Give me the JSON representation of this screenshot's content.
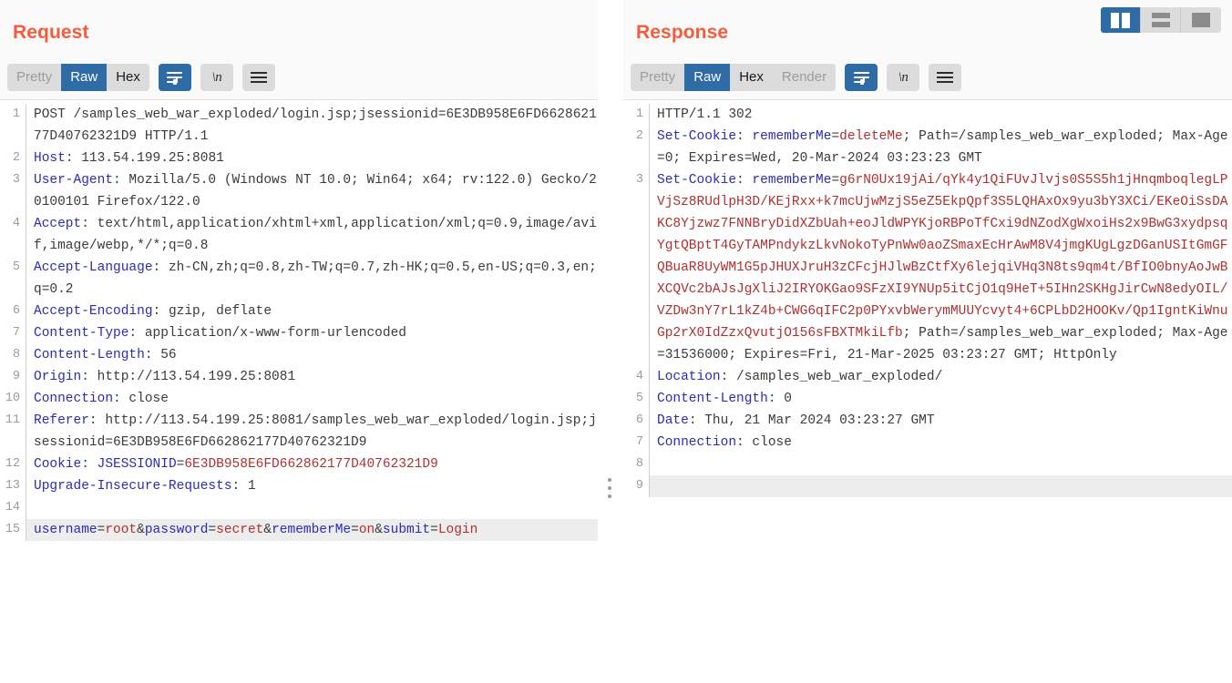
{
  "layout_switcher": {
    "buttons": [
      {
        "name": "side-by-side",
        "label": "",
        "active": true
      },
      {
        "name": "stacked",
        "label": "",
        "active": false
      },
      {
        "name": "single",
        "label": "",
        "active": false
      }
    ]
  },
  "request": {
    "title": "Request",
    "tabs": [
      {
        "label": "Pretty",
        "state": "disabled"
      },
      {
        "label": "Raw",
        "state": "active"
      },
      {
        "label": "Hex",
        "state": "normal"
      }
    ],
    "buttons": {
      "word_wrap": {
        "icon": "word-wrap-icon",
        "active": true
      },
      "special_chars": {
        "icon": "newline-icon",
        "label": "\\n",
        "active": false
      },
      "menu": {
        "icon": "hamburger-menu-icon",
        "active": false
      }
    },
    "lines": [
      {
        "n": "1",
        "segs": [
          {
            "t": "POST /samples_web_war_exploded/login.jsp;jsessionid=6E3DB958E6FD662862177D40762321D9 HTTP/1.1",
            "c": "p"
          }
        ]
      },
      {
        "n": "2",
        "segs": [
          {
            "t": "Host",
            "c": "k"
          },
          {
            "t": ": ",
            "c": "p"
          },
          {
            "t": "113.54.199.25:8081",
            "c": "p"
          }
        ]
      },
      {
        "n": "3",
        "segs": [
          {
            "t": "User-Agent",
            "c": "k"
          },
          {
            "t": ": ",
            "c": "p"
          },
          {
            "t": "Mozilla/5.0 (Windows NT 10.0; Win64; x64; rv:122.0) Gecko/20100101 Firefox/122.0",
            "c": "p"
          }
        ]
      },
      {
        "n": "4",
        "segs": [
          {
            "t": "Accept",
            "c": "k"
          },
          {
            "t": ": ",
            "c": "p"
          },
          {
            "t": "text/html,application/xhtml+xml,application/xml;q=0.9,image/avif,image/webp,*/*;q=0.8",
            "c": "p"
          }
        ]
      },
      {
        "n": "5",
        "segs": [
          {
            "t": "Accept-Language",
            "c": "k"
          },
          {
            "t": ": ",
            "c": "p"
          },
          {
            "t": "zh-CN,zh;q=0.8,zh-TW;q=0.7,zh-HK;q=0.5,en-US;q=0.3,en;q=0.2",
            "c": "p"
          }
        ]
      },
      {
        "n": "6",
        "segs": [
          {
            "t": "Accept-Encoding",
            "c": "k"
          },
          {
            "t": ": ",
            "c": "p"
          },
          {
            "t": "gzip, deflate",
            "c": "p"
          }
        ]
      },
      {
        "n": "7",
        "segs": [
          {
            "t": "Content-Type",
            "c": "k"
          },
          {
            "t": ": ",
            "c": "p"
          },
          {
            "t": "application/x-www-form-urlencoded",
            "c": "p"
          }
        ]
      },
      {
        "n": "8",
        "segs": [
          {
            "t": "Content-Length",
            "c": "k"
          },
          {
            "t": ": ",
            "c": "p"
          },
          {
            "t": "56",
            "c": "p"
          }
        ]
      },
      {
        "n": "9",
        "segs": [
          {
            "t": "Origin",
            "c": "k"
          },
          {
            "t": ": ",
            "c": "p"
          },
          {
            "t": "http://113.54.199.25:8081",
            "c": "p"
          }
        ]
      },
      {
        "n": "10",
        "segs": [
          {
            "t": "Connection",
            "c": "k"
          },
          {
            "t": ": ",
            "c": "p"
          },
          {
            "t": "close",
            "c": "p"
          }
        ]
      },
      {
        "n": "11",
        "segs": [
          {
            "t": "Referer",
            "c": "k"
          },
          {
            "t": ": ",
            "c": "p"
          },
          {
            "t": "http://113.54.199.25:8081/samples_web_war_exploded/login.jsp;jsessionid=6E3DB958E6FD662862177D40762321D9",
            "c": "p"
          }
        ]
      },
      {
        "n": "12",
        "segs": [
          {
            "t": "Cookie",
            "c": "k"
          },
          {
            "t": ": ",
            "c": "p"
          },
          {
            "t": "JSESSIONID",
            "c": "k"
          },
          {
            "t": "=",
            "c": "p"
          },
          {
            "t": "6E3DB958E6FD662862177D40762321D9",
            "c": "r"
          }
        ]
      },
      {
        "n": "13",
        "segs": [
          {
            "t": "Upgrade-Insecure-Requests",
            "c": "k"
          },
          {
            "t": ": ",
            "c": "p"
          },
          {
            "t": "1",
            "c": "p"
          }
        ]
      },
      {
        "n": "14",
        "segs": []
      },
      {
        "n": "15",
        "highlight": true,
        "segs": [
          {
            "t": "username",
            "c": "k"
          },
          {
            "t": "=",
            "c": "p"
          },
          {
            "t": "root",
            "c": "r"
          },
          {
            "t": "&",
            "c": "p"
          },
          {
            "t": "password",
            "c": "k"
          },
          {
            "t": "=",
            "c": "p"
          },
          {
            "t": "secret",
            "c": "r"
          },
          {
            "t": "&",
            "c": "p"
          },
          {
            "t": "rememberMe",
            "c": "k"
          },
          {
            "t": "=",
            "c": "p"
          },
          {
            "t": "on",
            "c": "r"
          },
          {
            "t": "&",
            "c": "p"
          },
          {
            "t": "submit",
            "c": "k"
          },
          {
            "t": "=",
            "c": "p"
          },
          {
            "t": "Login",
            "c": "r"
          }
        ]
      }
    ]
  },
  "response": {
    "title": "Response",
    "tabs": [
      {
        "label": "Pretty",
        "state": "disabled"
      },
      {
        "label": "Raw",
        "state": "active"
      },
      {
        "label": "Hex",
        "state": "normal"
      },
      {
        "label": "Render",
        "state": "disabled"
      }
    ],
    "buttons": {
      "word_wrap": {
        "icon": "word-wrap-icon",
        "active": true
      },
      "special_chars": {
        "icon": "newline-icon",
        "label": "\\n",
        "active": false
      },
      "menu": {
        "icon": "hamburger-menu-icon",
        "active": false
      }
    },
    "lines": [
      {
        "n": "1",
        "segs": [
          {
            "t": "HTTP/1.1 302",
            "c": "p"
          }
        ]
      },
      {
        "n": "2",
        "segs": [
          {
            "t": "Set-Cookie",
            "c": "k"
          },
          {
            "t": ": ",
            "c": "p"
          },
          {
            "t": "rememberMe",
            "c": "k"
          },
          {
            "t": "=",
            "c": "p"
          },
          {
            "t": "deleteMe",
            "c": "r"
          },
          {
            "t": "; Path=/samples_web_war_exploded; Max-Age=0; Expires=Wed, 20-Mar-2024 03:23:23 GMT",
            "c": "p"
          }
        ]
      },
      {
        "n": "3",
        "segs": [
          {
            "t": "Set-Cookie",
            "c": "k"
          },
          {
            "t": ": ",
            "c": "p"
          },
          {
            "t": "rememberMe",
            "c": "k"
          },
          {
            "t": "=",
            "c": "p"
          },
          {
            "t": "g6rN0Ux19jAi/qYk4y1QiFUvJlvjs0S5S5h1jHnqmboqlegLPVjSz8RUdlpH3D/KEjRxx+k7mcUjwMzjS5eZ5EkpQpf3S5LQHAxOx9yu3bY3XCi/EKeOiSsDAKC8Yjzwz7FNNBryDidXZbUah+eoJldWPYKjoRBPoTfCxi9dNZodXgWxoiHs2x9BwG3xydpsqYgtQBptT4GyTAMPndykzLkvNokoTyPnWw0aoZSmaxEcHrAwM8V4jmgKUgLgzDGanUSItGmGFQBuaR8UyWM1G5pJHUXJruH3zCFcjHJlwBzCtfXy6lejqiVHq3N8ts9qm4t/BfIO0bnyAoJwBXCQVc2bAJsJgXliJ2IRYOKGao9SFzXI9YNUp5itCjO1q9HeT+5IHn2SKHgJirCwN8edyOIL/VZDw3nY7rL1kZ4b+CWG6qIFC2p0PYxvbWerymMUUYcvyt4+6CPLbD2HOOKv/Qp1IgntKiWnuGp2rX0IdZzxQvutjO156sFBXTMkiLfb",
            "c": "r"
          },
          {
            "t": "; Path=/samples_web_war_exploded; Max-Age=31536000; Expires=Fri, 21-Mar-2025 03:23:27 GMT; HttpOnly",
            "c": "p"
          }
        ]
      },
      {
        "n": "4",
        "segs": [
          {
            "t": "Location",
            "c": "k"
          },
          {
            "t": ": ",
            "c": "p"
          },
          {
            "t": "/samples_web_war_exploded/",
            "c": "p"
          }
        ]
      },
      {
        "n": "5",
        "segs": [
          {
            "t": "Content-Length",
            "c": "k"
          },
          {
            "t": ": ",
            "c": "p"
          },
          {
            "t": "0",
            "c": "p"
          }
        ]
      },
      {
        "n": "6",
        "segs": [
          {
            "t": "Date",
            "c": "k"
          },
          {
            "t": ": ",
            "c": "p"
          },
          {
            "t": "Thu, 21 Mar 2024 03:23:27 GMT",
            "c": "p"
          }
        ]
      },
      {
        "n": "7",
        "segs": [
          {
            "t": "Connection",
            "c": "k"
          },
          {
            "t": ": ",
            "c": "p"
          },
          {
            "t": "close",
            "c": "p"
          }
        ]
      },
      {
        "n": "8",
        "segs": []
      },
      {
        "n": "9",
        "highlight": true,
        "segs": []
      }
    ]
  },
  "colors": {
    "title": "#f65c3c",
    "active_tab_bg": "#2f6ca5",
    "tab_bg": "#dcdcdc",
    "header_name": "#2b2bb5",
    "value_red": "#b03030",
    "value_plain": "#3b3b3b",
    "gutter_text": "#9b9b9b",
    "highlight_row": "#ededed"
  }
}
